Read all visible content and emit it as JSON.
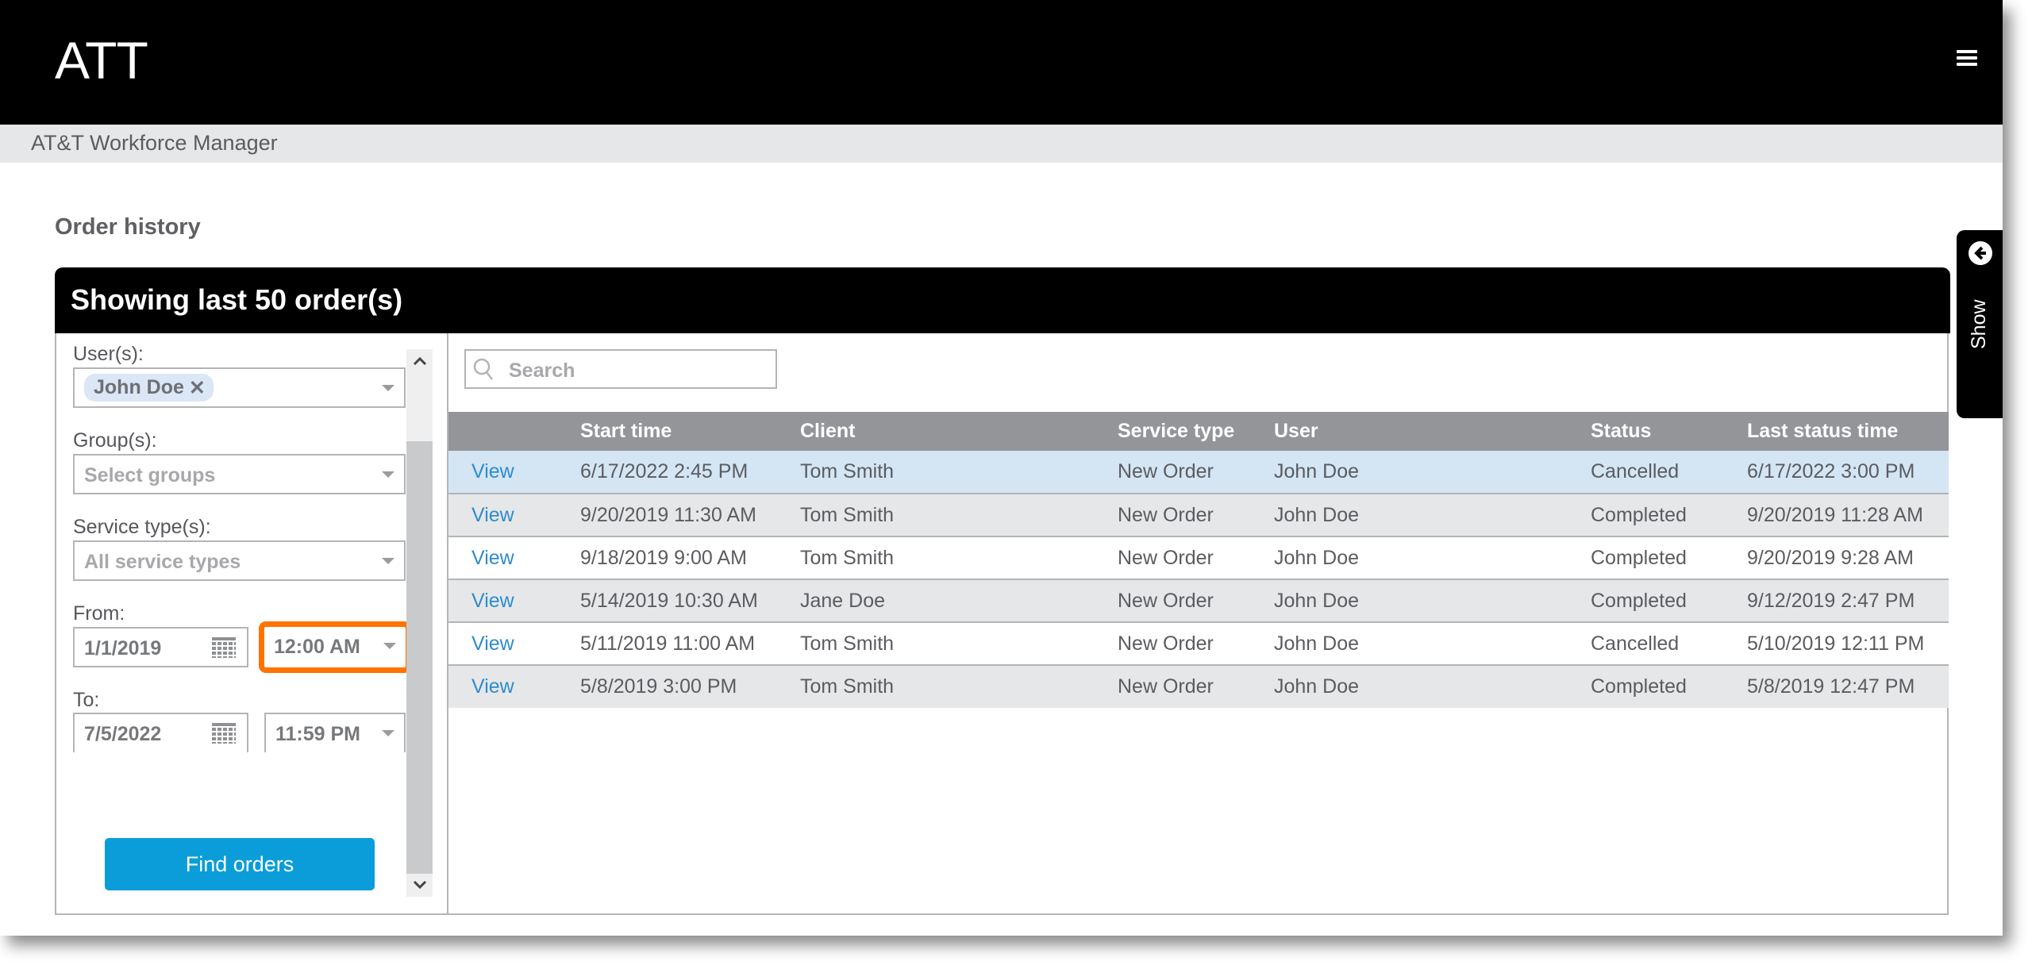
{
  "header": {
    "brand": "ATT",
    "menu_icon": "hamburger-menu-icon"
  },
  "subheader": {
    "title": "AT&T Workforce Manager"
  },
  "page": {
    "title": "Order history"
  },
  "panel": {
    "title": "Showing last 50 order(s)"
  },
  "filters": {
    "users_label": "User(s):",
    "users_selected": [
      "John Doe"
    ],
    "chip_remove_glyph": "✕",
    "groups_label": "Group(s):",
    "groups_placeholder": "Select groups",
    "service_types_label": "Service type(s):",
    "service_types_placeholder": "All service types",
    "from_label": "From:",
    "from_date": "1/1/2019",
    "from_time": "12:00 AM",
    "to_label": "To:",
    "to_date": "7/5/2022",
    "to_time": "11:59 PM",
    "find_button": "Find orders",
    "highlight_color": "#ff7300",
    "scroll_up_glyph": "⌃",
    "scroll_down_glyph": "⌄"
  },
  "search": {
    "placeholder": "Search"
  },
  "table": {
    "columns": [
      "",
      "Start time",
      "Client",
      "Service type",
      "User",
      "Status",
      "Last status time"
    ],
    "rows": [
      {
        "action": "View",
        "start_time": "6/17/2022 2:45 PM",
        "client": "Tom Smith",
        "service_type": "New Order",
        "user": "John Doe",
        "status": "Cancelled",
        "last_status_time": "6/17/2022 3:00 PM",
        "selected": true
      },
      {
        "action": "View",
        "start_time": "9/20/2019 11:30 AM",
        "client": "Tom Smith",
        "service_type": "New Order",
        "user": "John Doe",
        "status": "Completed",
        "last_status_time": "9/20/2019 11:28 AM"
      },
      {
        "action": "View",
        "start_time": "9/18/2019 9:00 AM",
        "client": "Tom Smith",
        "service_type": "New Order",
        "user": "John Doe",
        "status": "Completed",
        "last_status_time": "9/20/2019 9:28 AM"
      },
      {
        "action": "View",
        "start_time": "5/14/2019 10:30 AM",
        "client": "Jane Doe",
        "service_type": "New Order",
        "user": "John Doe",
        "status": "Completed",
        "last_status_time": "9/12/2019 2:47 PM"
      },
      {
        "action": "View",
        "start_time": "5/11/2019 11:00 AM",
        "client": "Tom Smith",
        "service_type": "New Order",
        "user": "John Doe",
        "status": "Cancelled",
        "last_status_time": "5/10/2019 12:11 PM"
      },
      {
        "action": "View",
        "start_time": "5/8/2019 3:00 PM",
        "client": "Tom Smith",
        "service_type": "New Order",
        "user": "John Doe",
        "status": "Completed",
        "last_status_time": "5/8/2019 12:47 PM"
      }
    ]
  },
  "side_tab": {
    "label": "Show",
    "icon": "arrow-left-circle-icon"
  },
  "colors": {
    "accent_button": "#0a9dd9",
    "link": "#2e8ccc",
    "table_header": "#939598",
    "selected_row": "#d4e5f4",
    "alt_row": "#e6e7e9"
  }
}
